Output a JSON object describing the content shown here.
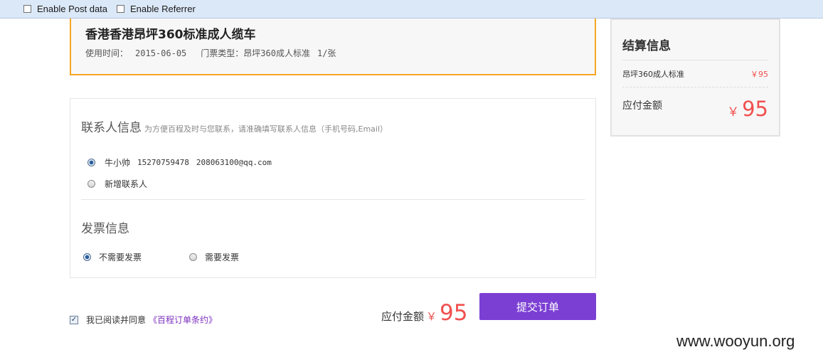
{
  "toolbar": {
    "enable_post_label": "Enable Post data",
    "enable_referrer_label": "Enable Referrer"
  },
  "ticket": {
    "title": "香港香港昂坪360标准成人缆车",
    "use_date_label": "使用时间：",
    "use_date": "2015-06-05",
    "ticket_type_label": "门票类型：",
    "ticket_type": "昂坪360成人标准",
    "quantity": "1/张"
  },
  "contact": {
    "title": "联系人信息",
    "hint": "为方便百程及时与您联系，请准确填写联系人信息（手机号码,Email）",
    "options": [
      {
        "name": "牛小帅",
        "phone": "15270759478",
        "email": "208063100@qq.com",
        "selected": true
      },
      {
        "label": "新增联系人",
        "selected": false
      }
    ]
  },
  "invoice": {
    "title": "发票信息",
    "options": [
      {
        "label": "不需要发票",
        "selected": true
      },
      {
        "label": "需要发票",
        "selected": false
      }
    ]
  },
  "summary": {
    "title": "结算信息",
    "item_name": "昂坪360成人标准",
    "item_price": "￥95",
    "total_label": "应付金额",
    "currency": "￥",
    "total": "95"
  },
  "footer": {
    "agree_checked": true,
    "agree_text": "我已阅读并同意",
    "agree_link": "《百程订单条约》",
    "pay_label": "应付金额",
    "pay_currency": "￥",
    "pay_amount": "95",
    "submit_label": "提交订单"
  },
  "watermark": "www.wooyun.org",
  "colors": {
    "accent_purple": "#7b3fd3",
    "price_red": "#f0504f",
    "ticket_border": "#f5a623",
    "toolbar_bg": "#dbe8f7"
  }
}
